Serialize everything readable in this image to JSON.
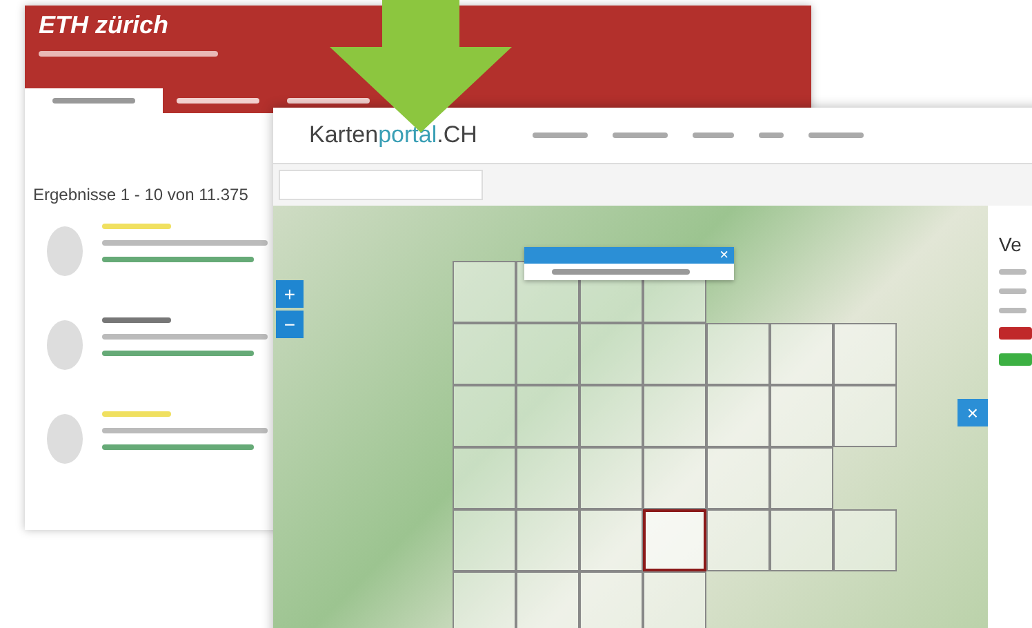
{
  "library_page": {
    "logo": "ETH zürich",
    "tabs": [
      {
        "selected": true
      },
      {
        "selected": false
      },
      {
        "selected": false
      }
    ],
    "results_heading": "Ergebnisse 1 - 10 von 11.375",
    "results": [
      {
        "highlighted": true
      },
      {
        "highlighted": false
      },
      {
        "highlighted": true
      }
    ]
  },
  "map_page": {
    "logo_parts": [
      {
        "text": "Karten",
        "color": "#444444"
      },
      {
        "text": "portal",
        "color": "#3a9fb5"
      },
      {
        "text": ".CH",
        "color": "#444444"
      }
    ],
    "zoom_in": "+",
    "zoom_out": "−",
    "popup_close": "×",
    "panel_close": "×",
    "panel_heading": "Ve",
    "tile_rows": [
      [
        {
          "selected": false
        },
        {
          "selected": false
        },
        {
          "selected": false
        },
        {
          "selected": false
        }
      ],
      [
        {
          "selected": false
        },
        {
          "selected": false
        },
        {
          "selected": false
        },
        {
          "selected": false
        },
        {
          "selected": false
        },
        {
          "selected": false
        },
        {
          "selected": false
        }
      ],
      [
        {
          "selected": false
        },
        {
          "selected": false
        },
        {
          "selected": false
        },
        {
          "selected": false
        },
        {
          "selected": false
        },
        {
          "selected": false
        },
        {
          "selected": false
        }
      ],
      [
        {
          "selected": false
        },
        {
          "selected": false
        },
        {
          "selected": false
        },
        {
          "selected": false
        },
        {
          "selected": false
        },
        {
          "selected": false
        }
      ],
      [
        {
          "selected": false
        },
        {
          "selected": false
        },
        {
          "selected": false
        },
        {
          "selected": true
        },
        {
          "selected": false
        },
        {
          "selected": false
        },
        {
          "selected": false
        }
      ],
      [
        {
          "selected": false
        },
        {
          "selected": false
        },
        {
          "selected": false
        },
        {
          "selected": false
        }
      ]
    ]
  }
}
